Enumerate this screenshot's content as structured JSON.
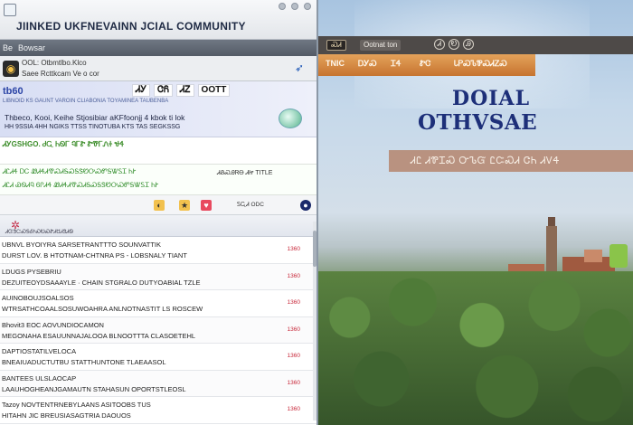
{
  "left": {
    "title": "JIINKED UKFNEVAINN JCIAL COMMUNITY",
    "menu": [
      "Be",
      "Bowsar"
    ],
    "account": {
      "line1": "OOL: Otbmtlbo.Klco",
      "line2": "Saee  Rcttkcam Ve o cor"
    },
    "banner": {
      "brand": "tb60",
      "sub": "LIBNOID  KS GAUNT VAROIN CLIABONIA  TOYAMINEA  TAUBENBA",
      "chips": [
        "ᏗᎩ",
        "ᏣᏲ",
        "ᏗᏃ",
        "OOTT"
      ],
      "line1": "Thbeco, Kooi, Keihe  Stjosibiar aKFfoonjj  4 kbok ti lok",
      "line2": "HH 9SSIA 4HH NGIKS  TTSS TINOTUBA KTS  TAS SEGKSSG"
    },
    "promo": {
      "line1": "ᏗᎩGSHGO. ᏧᏩ ᏂᏫᎱ ᏄᎱᏑ ᏑᏡᎱᏁᏐ  ᏠᏎ",
      "line2": ""
    },
    "notice": {
      "line1": "ᏗᏝᏗᏎ ᎠᏟ ᏪᏗᏎᏗᏡᏍᏗᎦᏍᎦᏕᏬᎤᏍᏛᎦᏔᏚᏆ ᏂᎨ",
      "line2": "ᏗᏝᏗ ᏯᏫᏗᏄ ᏮᎵᏗᏎ ᏪᏗᏎᏗᏡᏍᏗᎦᏍᎦᏕᏬᎤᏍᏛᎦᏔᏚᏆ ᏂᎨ",
      "right": "ᏗᏰᏍᎯᏒᎾ ᏗᏥ  TITLE"
    },
    "strip": {
      "label": "ᏚᏩᏗ ODC"
    },
    "section": {
      "label": "ᏗᏳᏕᏨᏍᎦᎴᎨᏍᎧᏍᏑᏗᏌᏗᏕᏗᏫ"
    },
    "feed": [
      {
        "a": "UBNVL BYOIYRA SARSETRANTTTO SOUNVATTIK",
        "b": "DURST LOV. B HTOTNAM-CHTNRA PS -  LOBSNALY TIANT",
        "time": "1360"
      },
      {
        "a": "LDUGS PYSEBRIU",
        "b": "DEZUITEOYDSAAAYLE  ·  CHAIN STGRALO DUTYOABIAL TZLE",
        "time": "1360"
      },
      {
        "a": "AUINOBOUJSOALSOS",
        "b": "WTRSATHCOAALSOSUWOAHRA ANLNOTNASTIT  LS ROSCEW",
        "time": "1360"
      },
      {
        "a": "Bhovit3 EOC AOVUNDIOCAMON",
        "b": "MEGONAHA ESAUUNNAJALOOA BLNOOTTTA CLASOETEHL",
        "time": "1360"
      },
      {
        "a": "DAPTIOSTATILVELOCA",
        "b": "BNEAIUADUCTUTBU  STATTHUNTONE  TLAEAASOL",
        "time": "1360"
      },
      {
        "a": "BANTEES ULSLAOCAP",
        "b": "LAAUHOGHEANJGAMAUTN  STAHASUN OPORTSTLEOSL",
        "time": "1360"
      },
      {
        "a": "Tazoy  NOVTENTRNEBYLAANS ASITOOBS  TUS",
        "b": "HITAHN  JIC  BREUSIASAGTRIA  DAOUOS",
        "time": "1360"
      }
    ]
  },
  "right": {
    "top_tab": "ᏍᏗ",
    "top_label": "Ootnat ton",
    "top_icons": [
      "Ꮧ",
      "Ꭷ",
      "Ꭿ"
    ],
    "nav": [
      "TNIC",
      "ᎠᎩᏍ",
      "ᏆᏎ",
      "ᏑᏣ",
      "ᏓᏢᏍᏖᏈᏍᏗᏃᏍ"
    ],
    "hero_line1": "DOIAL",
    "hero_line2": "OTHVSAE",
    "slogan": "ᏗᏝ ᏗᏈᏆᏍ  ᏅᏖᏳ  ᏝᏨᏍᏗ  ᏣᏂ ᏗᏙᏎ"
  },
  "colors": {
    "accent_orange": "#d4873e",
    "hero_blue": "#1d2f79",
    "time_red": "#c8283a",
    "promo_green": "#3e8e2c"
  },
  "icons": {
    "account": "camera-icon",
    "flag": "bird-icon",
    "banner_globe": "globe-icon",
    "section": "spark-icon"
  }
}
